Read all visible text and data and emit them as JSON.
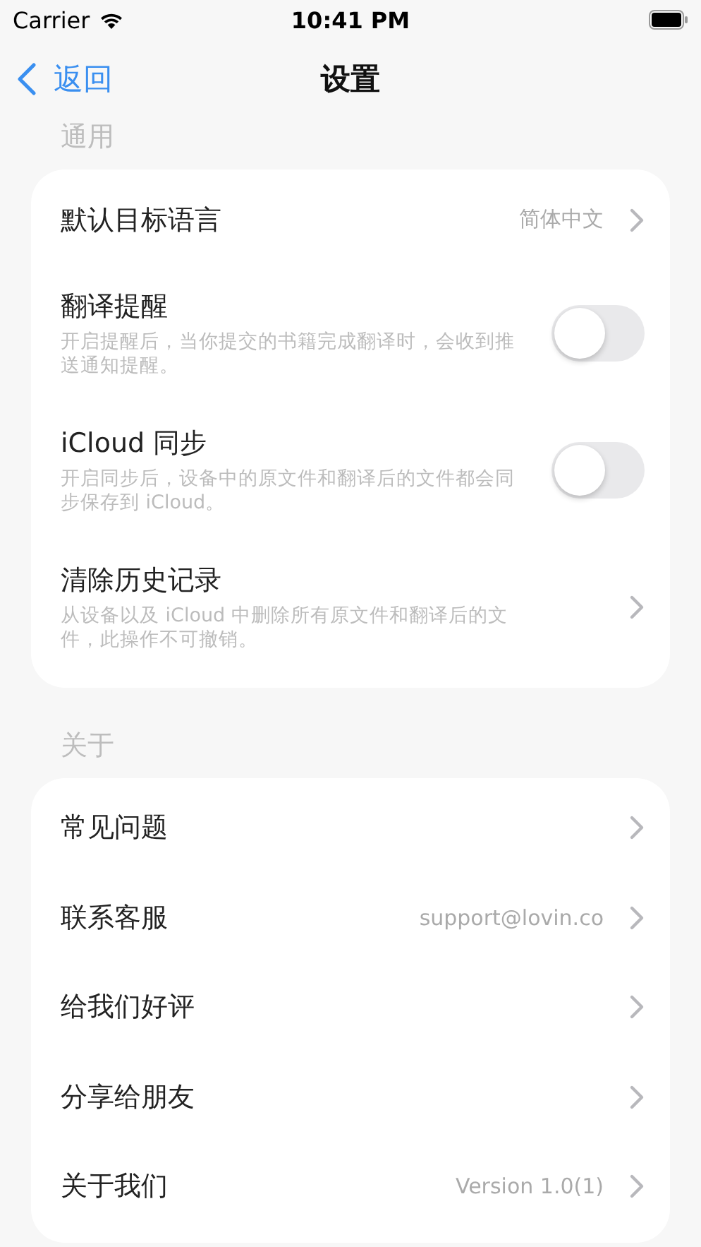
{
  "status_bar": {
    "carrier": "Carrier",
    "time": "10:41 PM"
  },
  "nav": {
    "back": "返回",
    "title": "设置"
  },
  "sections": [
    {
      "header": "通用",
      "items": [
        {
          "kind": "link",
          "title": "默认目标语言",
          "value": "简体中文"
        },
        {
          "kind": "toggle",
          "title": "翻译提醒",
          "description": "开启提醒后，当你提交的书籍完成翻译时，会收到推送通知提醒。",
          "on": false
        },
        {
          "kind": "toggle",
          "title": "iCloud 同步",
          "description": "开启同步后，设备中的原文件和翻译后的文件都会同步保存到 iCloud。",
          "on": false
        },
        {
          "kind": "link",
          "title": "清除历史记录",
          "description": "从设备以及 iCloud 中删除所有原文件和翻译后的文件，此操作不可撤销。"
        }
      ]
    },
    {
      "header": "关于",
      "items": [
        {
          "kind": "link",
          "title": "常见问题"
        },
        {
          "kind": "link",
          "title": "联系客服",
          "value": "support@lovin.co"
        },
        {
          "kind": "link",
          "title": "给我们好评"
        },
        {
          "kind": "link",
          "title": "分享给朋友"
        },
        {
          "kind": "link",
          "title": "关于我们",
          "value": "Version 1.0(1)"
        }
      ]
    }
  ]
}
